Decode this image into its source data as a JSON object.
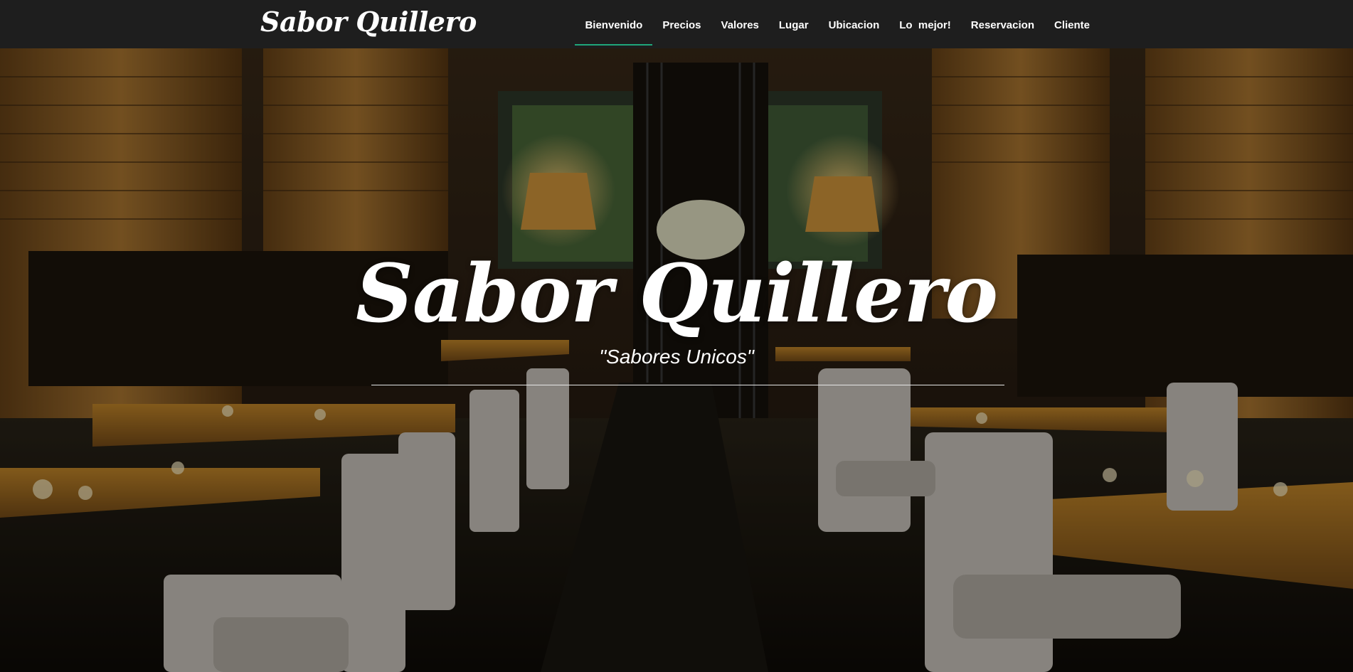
{
  "brand": {
    "name": "Sabor Quillero"
  },
  "nav": {
    "items": [
      {
        "label": "Bienvenido"
      },
      {
        "label": "Precios"
      },
      {
        "label": "Valores"
      },
      {
        "label": "Lugar"
      },
      {
        "label": "Ubicacion"
      },
      {
        "label": "Lo  mejor!"
      },
      {
        "label": "Reservacion"
      },
      {
        "label": "Cliente"
      }
    ],
    "active_index": 0,
    "active_color": "#1fa67a"
  },
  "hero": {
    "title": "Sabor Quillero",
    "subtitle": "\"Sabores Unicos\""
  },
  "colors": {
    "navbar_bg": "#1e1e1e",
    "text": "#ffffff"
  }
}
